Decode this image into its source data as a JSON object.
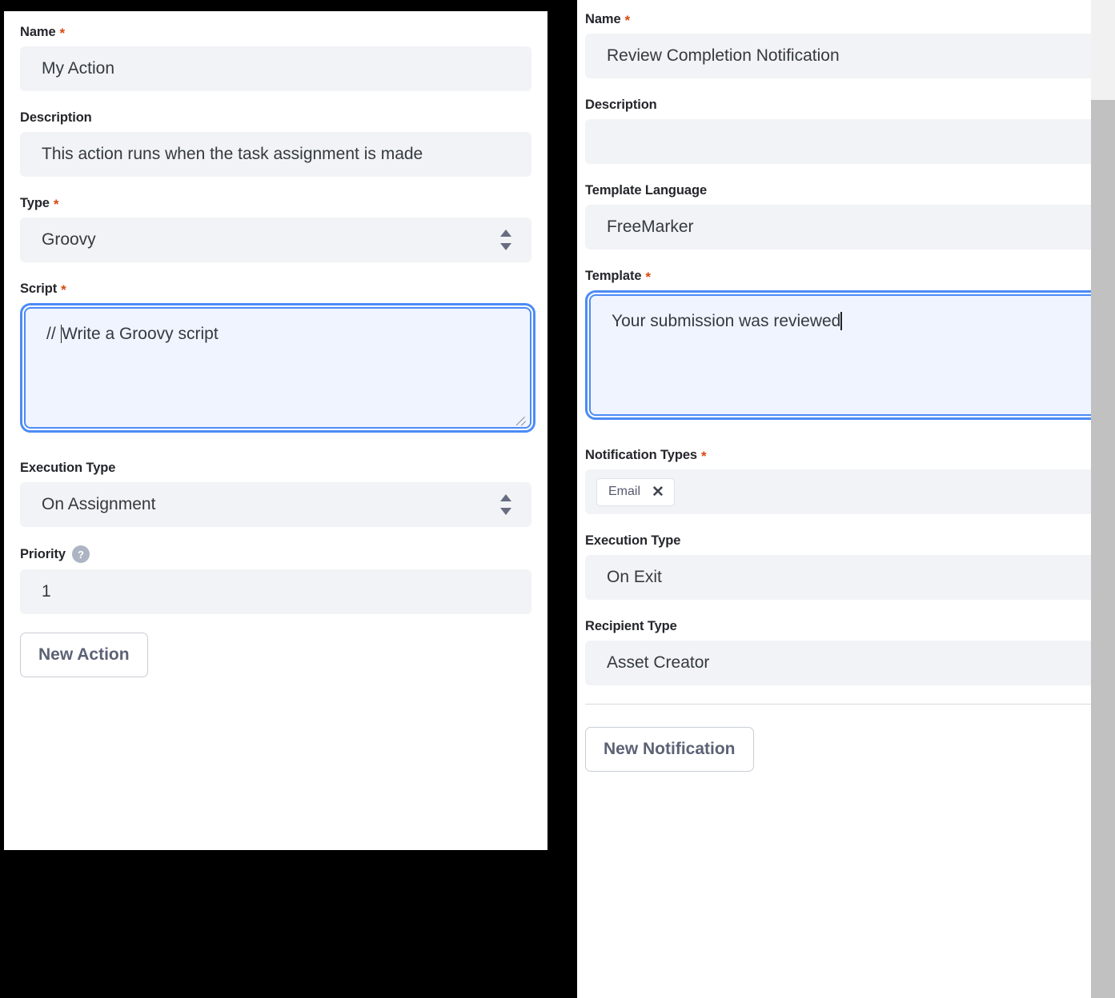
{
  "theme": {
    "required_marker": "*",
    "required_color": "#d9480f",
    "focus_color": "#4c8bf5",
    "input_bg": "#f1f3f6",
    "focus_bg": "#eff4fe",
    "scrollbar_thumb": "#c1c1c1"
  },
  "action_panel": {
    "name": {
      "label": "Name",
      "required": true,
      "value": "My Action"
    },
    "description": {
      "label": "Description",
      "required": false,
      "value": "This action runs when the task assignment is made"
    },
    "type": {
      "label": "Type",
      "required": true,
      "value": "Groovy",
      "options": [
        "Groovy"
      ]
    },
    "script": {
      "label": "Script",
      "required": true,
      "value": "// Write a Groovy script",
      "value_before_caret": "// ",
      "value_after_caret": "Write a Groovy script",
      "focused": true
    },
    "execution_type": {
      "label": "Execution Type",
      "required": false,
      "value": "On Assignment",
      "options": [
        "On Assignment"
      ]
    },
    "priority": {
      "label": "Priority",
      "help_tooltip_marker": "?",
      "required": false,
      "value": "1"
    },
    "new_action_button": "New Action"
  },
  "notification_panel": {
    "name": {
      "label": "Name",
      "required": true,
      "value": "Review Completion Notification"
    },
    "description": {
      "label": "Description",
      "required": false,
      "value": ""
    },
    "template_language": {
      "label": "Template Language",
      "required": false,
      "value": "FreeMarker",
      "options": [
        "FreeMarker"
      ]
    },
    "template": {
      "label": "Template",
      "required": true,
      "value": "Your submission was reviewed",
      "focused": true
    },
    "notification_types": {
      "label": "Notification Types",
      "required": true,
      "chips": [
        {
          "label": "Email",
          "remove_marker": "✕"
        }
      ]
    },
    "execution_type": {
      "label": "Execution Type",
      "required": false,
      "value": "On Exit",
      "options": [
        "On Exit"
      ]
    },
    "recipient_type": {
      "label": "Recipient Type",
      "required": false,
      "value": "Asset Creator",
      "options": [
        "Asset Creator"
      ]
    },
    "new_notification_button": "New Notification"
  }
}
